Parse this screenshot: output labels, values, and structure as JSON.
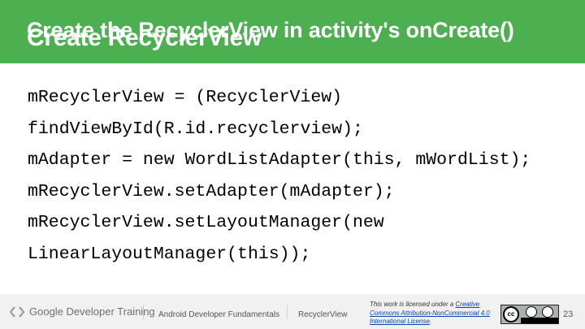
{
  "slide": {
    "title_overlap_a": "Create the RecyclerView in activity's onCreate()",
    "title_overlap_b": "Create RecyclerView",
    "code_lines": [
      "mRecyclerView = (RecyclerView)",
      "findViewById(R.id.recyclerview);",
      "mAdapter = new WordListAdapter(this, mWordList);",
      "mRecyclerView.setAdapter(mAdapter);",
      "mRecyclerView.setLayoutManager(new",
      "LinearLayoutManager(this));"
    ]
  },
  "footer": {
    "brand": "Google Developer Training",
    "course": "Android Developer Fundamentals",
    "topic": "RecyclerView",
    "license_prefix": "This work is licensed under a ",
    "license_link": "Creative Commons Attribution-NonCommercial 4.0 International License",
    "license_suffix": ".",
    "cc_label": "cc",
    "page_number": "23"
  },
  "colors": {
    "header": "#4caf50",
    "footer_bg": "#f1f1f1"
  },
  "icons": {
    "brand_logo": "google-chevrons-icon",
    "license_badge": "creative-commons-by-nc-badge"
  }
}
